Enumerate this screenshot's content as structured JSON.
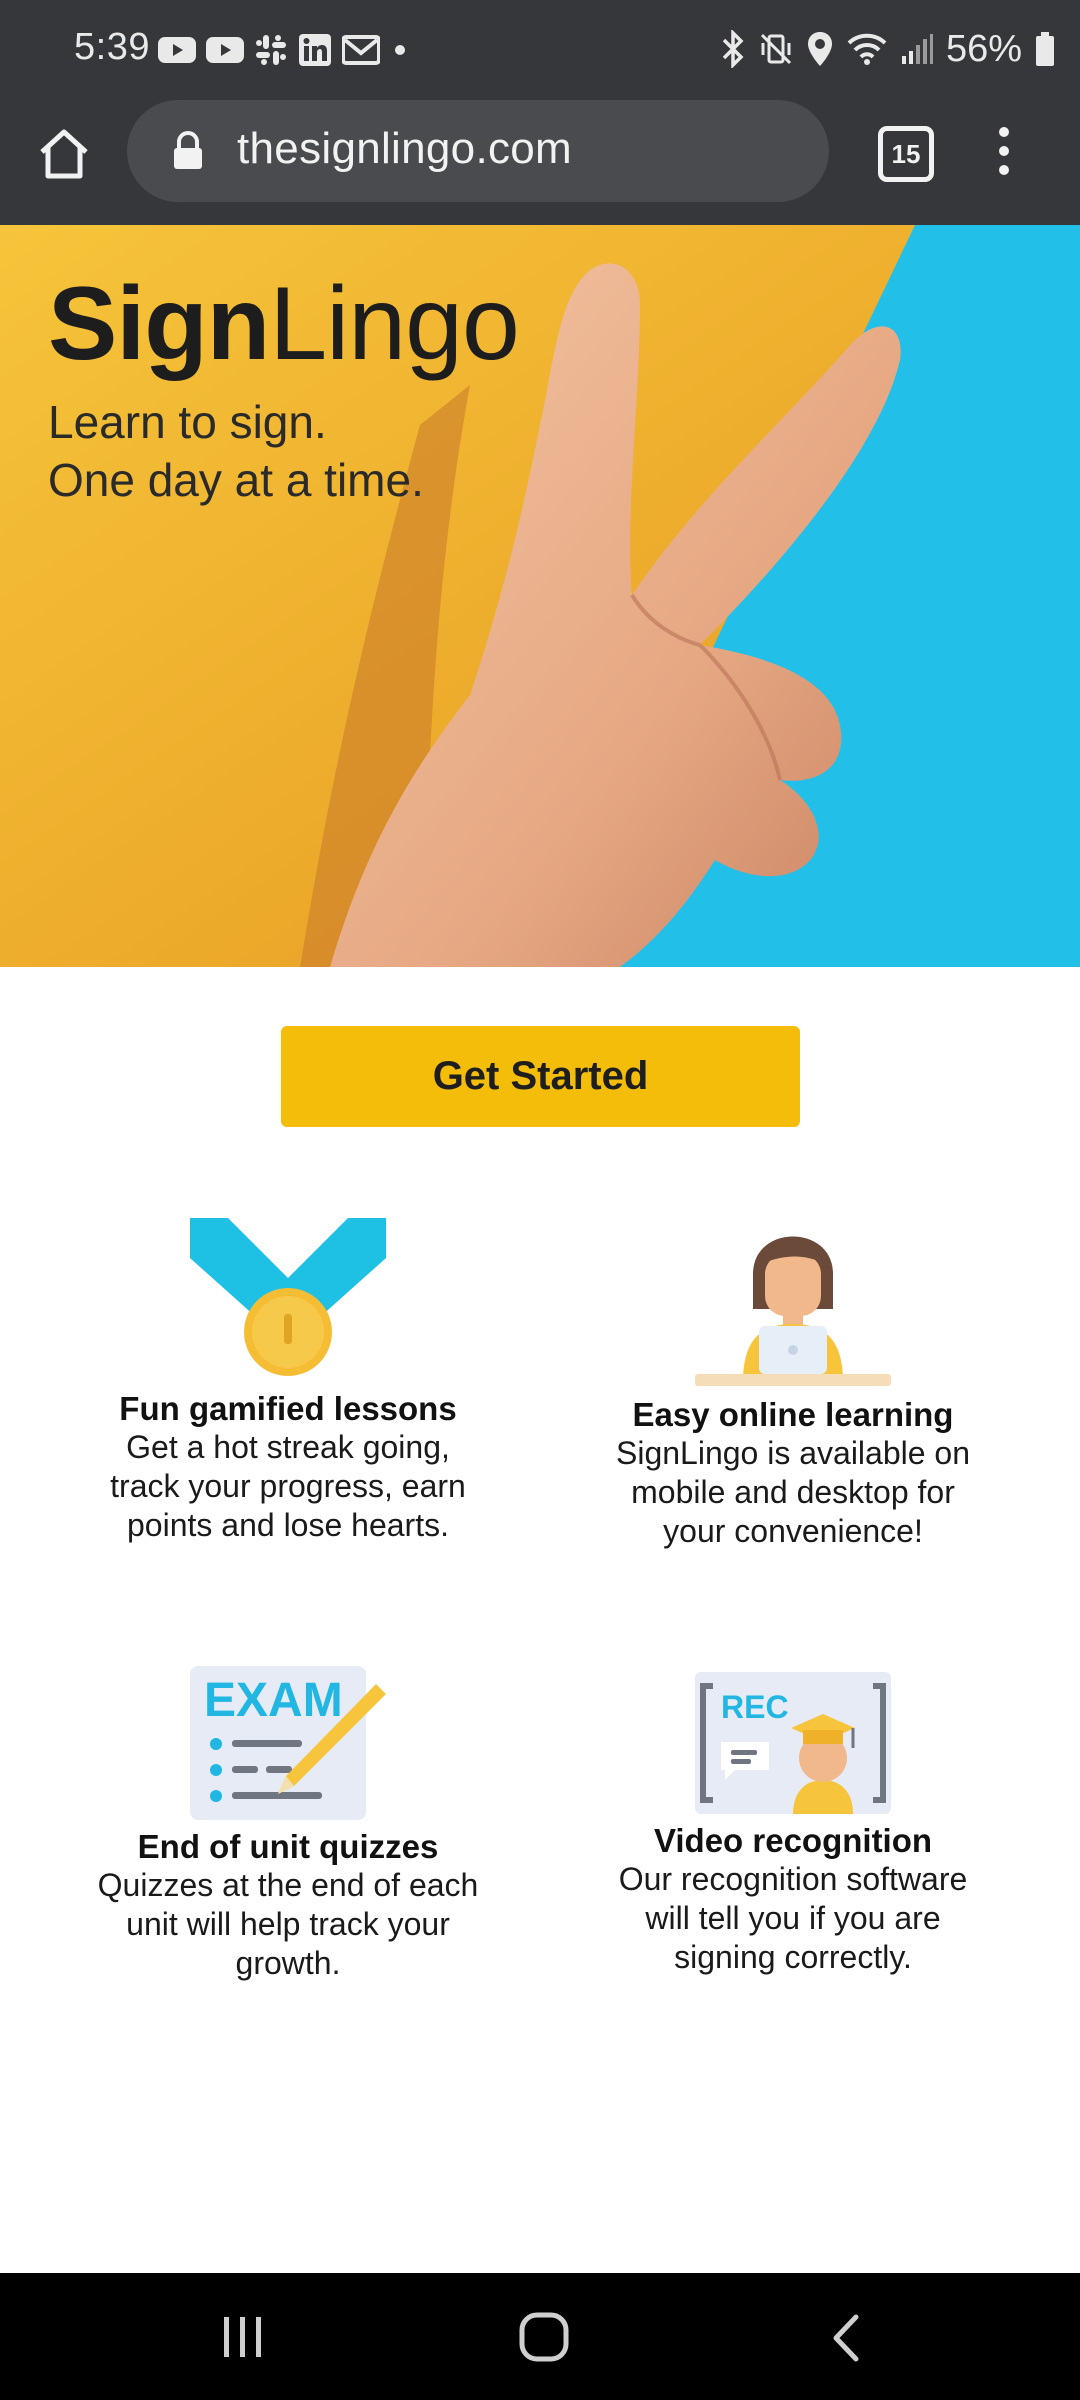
{
  "status_bar": {
    "time": "5:39",
    "battery_percent": "56%",
    "left_icons": [
      "youtube-icon",
      "youtube-icon",
      "slack-icon",
      "linkedin-icon",
      "gmail-icon",
      "dot-icon"
    ],
    "right_icons": [
      "bluetooth-icon",
      "vibrate-icon",
      "location-icon",
      "wifi-icon",
      "signal-icon",
      "battery-icon"
    ]
  },
  "browser": {
    "url": "thesignlingo.com",
    "tab_count": "15"
  },
  "hero": {
    "brand_bold": "Sign",
    "brand_light": "Lingo",
    "tagline_line1": "Learn to sign.",
    "tagline_line2": "One day at a time.",
    "colors": {
      "yellow": "#f0b12a",
      "blue": "#22c0e8"
    }
  },
  "cta": {
    "label": "Get Started",
    "color": "#f4bd0a"
  },
  "features": [
    {
      "title": "Fun gamified lessons",
      "desc_lines": [
        "Get a hot streak going,",
        "track your progress, earn",
        "points and lose hearts."
      ],
      "icon": "medal-icon"
    },
    {
      "title": "Easy online learning",
      "desc_lines": [
        "SignLingo is available on",
        "mobile and desktop for",
        "your convenience!"
      ],
      "icon": "person-laptop-icon"
    },
    {
      "title": "End of unit quizzes",
      "desc_lines": [
        "Quizzes at the end of each",
        "unit will help track your",
        "growth."
      ],
      "icon": "exam-icon",
      "icon_text": "EXAM"
    },
    {
      "title": "Video recognition",
      "desc_lines": [
        "Our recognition software",
        "will tell you if you are",
        "signing correctly."
      ],
      "icon": "video-rec-icon",
      "icon_text": "REC"
    }
  ]
}
